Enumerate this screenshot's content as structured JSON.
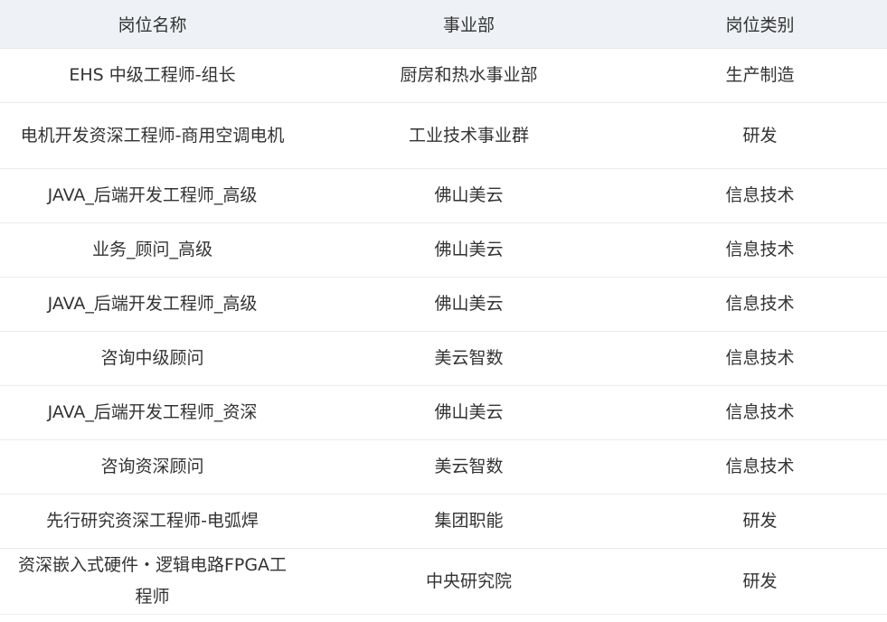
{
  "table": {
    "headers": [
      "岗位名称",
      "事业部",
      "岗位类别"
    ],
    "rows": [
      {
        "title": "EHS 中级工程师-组长",
        "department": "厨房和热水事业部",
        "category": "生产制造"
      },
      {
        "title": "电机开发资深工程师-商用空调电机",
        "department": "工业技术事业群",
        "category": "研发"
      },
      {
        "title": "JAVA_后端开发工程师_高级",
        "department": "佛山美云",
        "category": "信息技术"
      },
      {
        "title": "业务_顾问_高级",
        "department": "佛山美云",
        "category": "信息技术"
      },
      {
        "title": "JAVA_后端开发工程师_高级",
        "department": "佛山美云",
        "category": "信息技术"
      },
      {
        "title": "咨询中级顾问",
        "department": "美云智数",
        "category": "信息技术"
      },
      {
        "title": "JAVA_后端开发工程师_资深",
        "department": "佛山美云",
        "category": "信息技术"
      },
      {
        "title": "咨询资深顾问",
        "department": "美云智数",
        "category": "信息技术"
      },
      {
        "title": "先行研究资深工程师-电弧焊",
        "department": "集团职能",
        "category": "研发"
      },
      {
        "title": "资深嵌入式硬件・逻辑电路FPGA工程师",
        "department": "中央研究院",
        "category": "研发"
      }
    ]
  }
}
